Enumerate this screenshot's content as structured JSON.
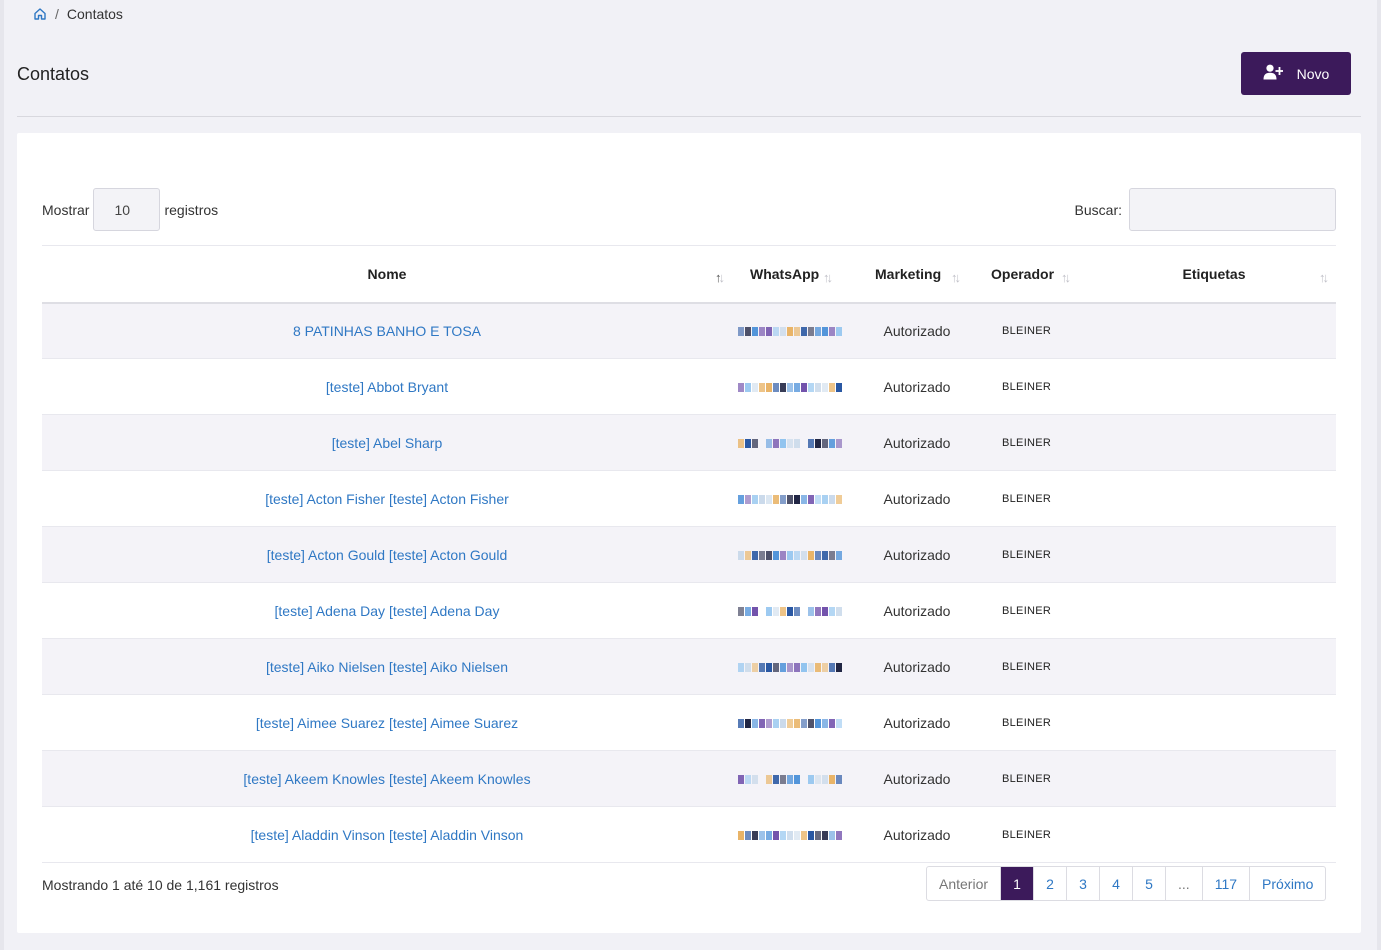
{
  "breadcrumb": {
    "current": "Contatos"
  },
  "header": {
    "title": "Contatos",
    "new_button": "Novo"
  },
  "length": {
    "label_before": "Mostrar",
    "value": "10",
    "label_after": "registros"
  },
  "search": {
    "label": "Buscar:",
    "value": ""
  },
  "table": {
    "columns": [
      "Nome",
      "WhatsApp",
      "Marketing",
      "Operador",
      "Etiquetas"
    ],
    "rows": [
      {
        "nome": "8 PATINHAS BANHO E TOSA",
        "marketing": "Autorizado",
        "operador": "BLEINER"
      },
      {
        "nome": "[teste] Abbot Bryant",
        "marketing": "Autorizado",
        "operador": "BLEINER"
      },
      {
        "nome": "[teste] Abel Sharp",
        "marketing": "Autorizado",
        "operador": "BLEINER"
      },
      {
        "nome": "[teste] Acton Fisher [teste] Acton Fisher",
        "marketing": "Autorizado",
        "operador": "BLEINER"
      },
      {
        "nome": "[teste] Acton Gould [teste] Acton Gould",
        "marketing": "Autorizado",
        "operador": "BLEINER"
      },
      {
        "nome": "[teste] Adena Day [teste] Adena Day",
        "marketing": "Autorizado",
        "operador": "BLEINER"
      },
      {
        "nome": "[teste] Aiko Nielsen [teste] Aiko Nielsen",
        "marketing": "Autorizado",
        "operador": "BLEINER"
      },
      {
        "nome": "[teste] Aimee Suarez [teste] Aimee Suarez",
        "marketing": "Autorizado",
        "operador": "BLEINER"
      },
      {
        "nome": "[teste] Akeem Knowles [teste] Akeem Knowles",
        "marketing": "Autorizado",
        "operador": "BLEINER"
      },
      {
        "nome": "[teste] Aladdin Vinson [teste] Aladdin Vinson",
        "marketing": "Autorizado",
        "operador": "BLEINER"
      }
    ]
  },
  "footer": {
    "info": "Mostrando 1 até 10 de 1,161 registros",
    "pagination": {
      "previous": "Anterior",
      "pages": [
        "1",
        "2",
        "3",
        "4",
        "5",
        "...",
        "117"
      ],
      "active": "1",
      "next": "Próximo"
    }
  },
  "colors": {
    "accent": "#3c1a5b",
    "link": "#2f78c4",
    "pixelated_whatsapp": [
      "#1f4f9e",
      "#4a8fd8",
      "#8cc1ee",
      "#e8b060",
      "#151a3a",
      "#6b4aa8",
      "#c8d8ea"
    ]
  }
}
